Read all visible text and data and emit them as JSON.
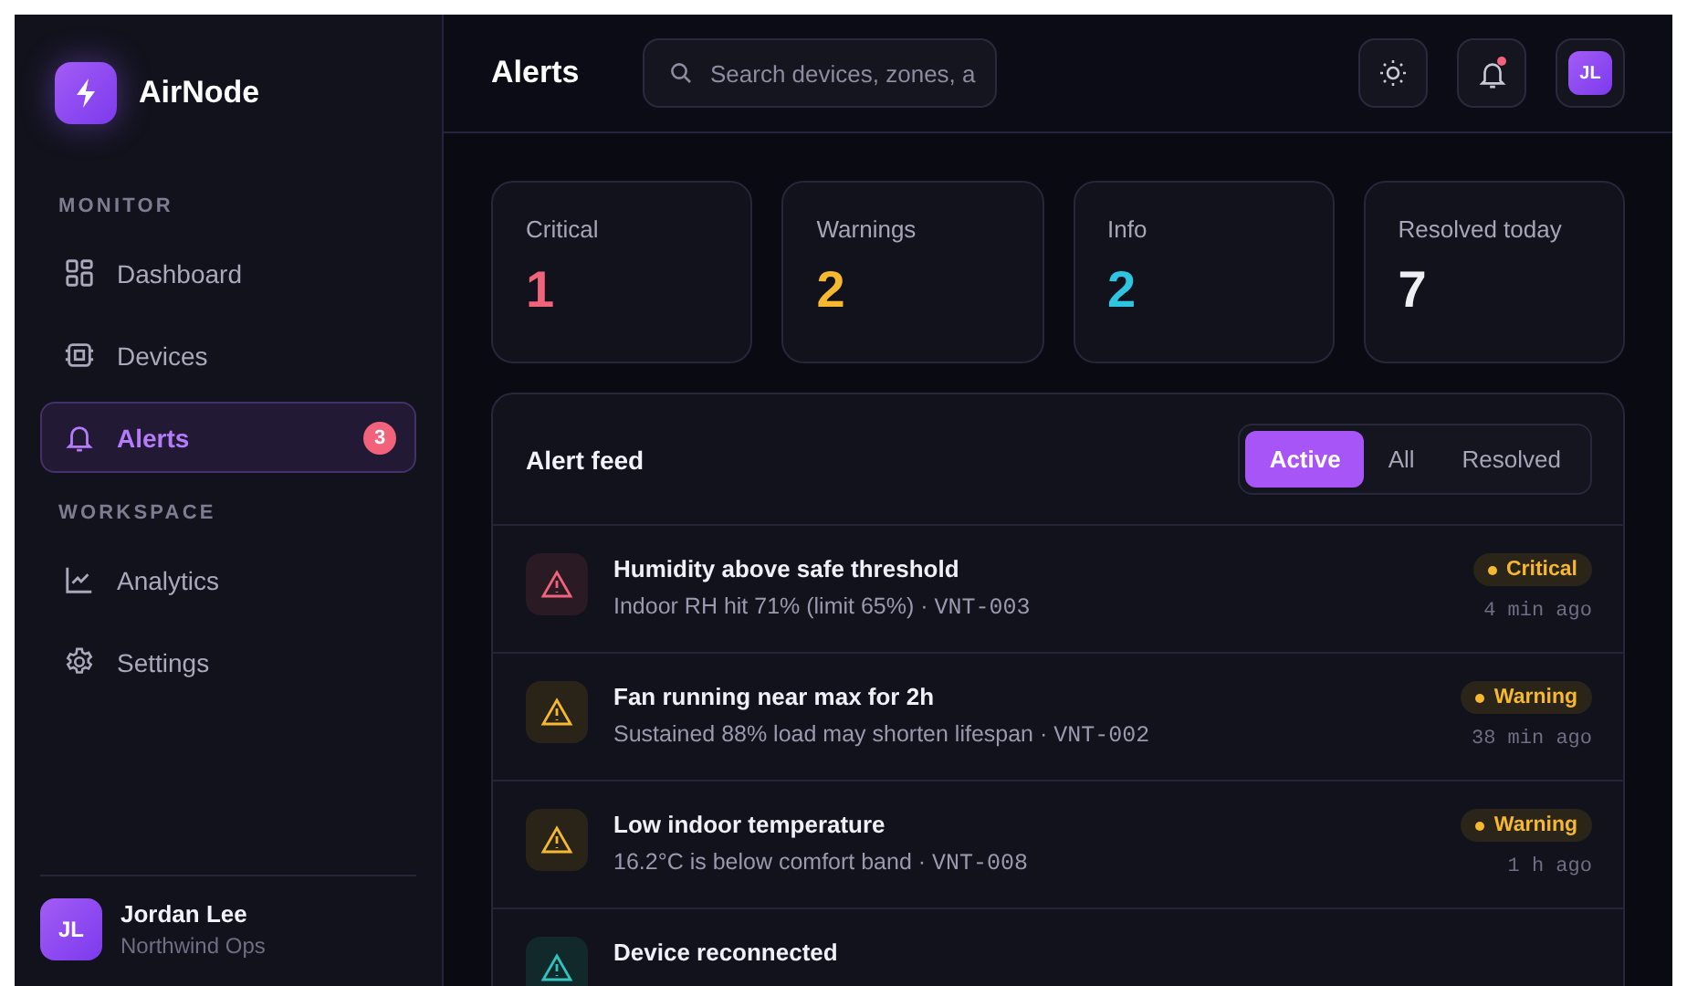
{
  "brand": {
    "name": "AirNode"
  },
  "sidebar": {
    "sections": [
      {
        "heading": "MONITOR",
        "items": [
          {
            "label": "Dashboard",
            "kind": "grid",
            "selected": false
          },
          {
            "label": "Devices",
            "kind": "chip",
            "selected": false
          },
          {
            "label": "Alerts",
            "kind": "bell",
            "selected": true,
            "badge": "3"
          }
        ]
      },
      {
        "heading": "WORKSPACE",
        "items": [
          {
            "label": "Analytics",
            "kind": "chart",
            "selected": false
          },
          {
            "label": "Settings",
            "kind": "gear",
            "selected": false
          }
        ]
      }
    ],
    "user": {
      "initials": "JL",
      "name": "Jordan Lee",
      "org": "Northwind Ops"
    }
  },
  "header": {
    "title": "Alerts",
    "search": {
      "placeholder": "Search devices, zones, a"
    },
    "notification_dot": true,
    "avatar": "JL"
  },
  "stats": [
    {
      "label": "Critical",
      "value": "1",
      "color": "#f0637a"
    },
    {
      "label": "Warnings",
      "value": "2",
      "color": "#f5b82e"
    },
    {
      "label": "Info",
      "value": "2",
      "color": "#2ec5e0"
    },
    {
      "label": "Resolved today",
      "value": "7",
      "color": "#eeeef5"
    }
  ],
  "feed": {
    "title": "Alert feed",
    "filters": [
      {
        "label": "Active",
        "selected": true
      },
      {
        "label": "All",
        "selected": false
      },
      {
        "label": "Resolved",
        "selected": false
      }
    ],
    "alerts": [
      {
        "kind": "critical",
        "title": "Humidity above safe threshold",
        "detail": "Indoor RH hit 71% (limit 65%) · ",
        "device": "VNT-003",
        "badge": "Critical",
        "time": "4 min ago"
      },
      {
        "kind": "warning",
        "title": "Fan running near max for 2h",
        "detail": "Sustained 88% load may shorten lifespan · ",
        "device": "VNT-002",
        "badge": "Warning",
        "time": "38 min ago"
      },
      {
        "kind": "warning",
        "title": "Low indoor temperature",
        "detail": "16.2°C is below comfort band · ",
        "device": "VNT-008",
        "badge": "Warning",
        "time": "1 h ago"
      },
      {
        "kind": "info",
        "title": "Device reconnected"
      }
    ]
  }
}
